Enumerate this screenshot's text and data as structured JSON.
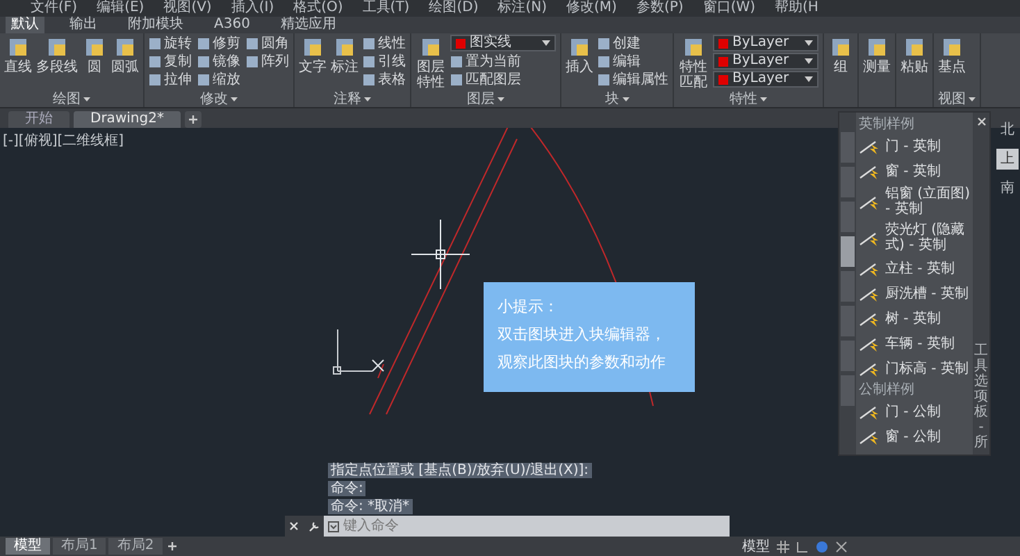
{
  "menu_bar": [
    "文件(F)",
    "编辑(E)",
    "视图(V)",
    "插入(I)",
    "格式(O)",
    "工具(T)",
    "绘图(D)",
    "标注(N)",
    "修改(M)",
    "参数(P)",
    "窗口(W)",
    "帮助(H"
  ],
  "ribbon_tabs": [
    {
      "label": "默认",
      "selected": true
    },
    {
      "label": "输出",
      "selected": false
    },
    {
      "label": "附加模块",
      "selected": false
    },
    {
      "label": "A360",
      "selected": false
    },
    {
      "label": "精选应用",
      "selected": false
    }
  ],
  "ribbon_panels": [
    {
      "title": "绘图",
      "tools": [
        {
          "kind": "large",
          "label": "直线"
        },
        {
          "kind": "large",
          "label": "多段线"
        },
        {
          "kind": "large",
          "label": "圆"
        },
        {
          "kind": "large",
          "label": "圆弧"
        }
      ]
    },
    {
      "title": "修改",
      "tools": [
        {
          "kind": "small",
          "label": "旋转"
        },
        {
          "kind": "small",
          "label": "复制"
        },
        {
          "kind": "small",
          "label": "拉伸"
        },
        {
          "kind": "small",
          "label": "修剪"
        },
        {
          "kind": "small",
          "label": "镜像"
        },
        {
          "kind": "small",
          "label": "缩放"
        },
        {
          "kind": "small",
          "label": "圆角"
        },
        {
          "kind": "small",
          "label": "阵列"
        }
      ]
    },
    {
      "title": "注释",
      "tools": [
        {
          "kind": "large",
          "label": "文字"
        },
        {
          "kind": "large",
          "label": "标注"
        },
        {
          "kind": "small",
          "label": "线性"
        },
        {
          "kind": "small",
          "label": "引线"
        },
        {
          "kind": "small",
          "label": "表格"
        }
      ]
    },
    {
      "title": "图层",
      "tools": [
        {
          "kind": "large",
          "label": "图层特性"
        },
        {
          "kind": "dropdown",
          "label": "图实线"
        },
        {
          "kind": "small",
          "label": "置为当前"
        },
        {
          "kind": "small",
          "label": "匹配图层"
        }
      ]
    },
    {
      "title": "块",
      "tools": [
        {
          "kind": "large",
          "label": "插入"
        },
        {
          "kind": "small",
          "label": "创建"
        },
        {
          "kind": "small",
          "label": "编辑"
        },
        {
          "kind": "small",
          "label": "编辑属性"
        }
      ]
    },
    {
      "title": "特性",
      "tools": [
        {
          "kind": "large",
          "label": "特性匹配"
        },
        {
          "kind": "dropdown",
          "label": "ByLayer"
        },
        {
          "kind": "dropdown",
          "label": "ByLayer"
        },
        {
          "kind": "dropdown",
          "label": "ByLayer"
        }
      ]
    },
    {
      "tools": [
        {
          "kind": "large",
          "label": "组"
        }
      ]
    },
    {
      "tools": [
        {
          "kind": "large",
          "label": "测量"
        }
      ]
    },
    {
      "tools": [
        {
          "kind": "large",
          "label": "粘贴"
        }
      ]
    },
    {
      "title": "视图",
      "tools": [
        {
          "kind": "large",
          "label": "基点"
        }
      ]
    }
  ],
  "document_tabs": [
    {
      "label": "开始",
      "selected": false
    },
    {
      "label": "Drawing2*",
      "selected": true
    }
  ],
  "viewport_label": "[-][俯视][二维线框]",
  "tool_palette": {
    "side_title": "工具选项板 - 所",
    "tabs": [
      {
        "selected": false
      },
      {
        "selected": false
      },
      {
        "selected": false
      },
      {
        "selected": true
      },
      {
        "selected": false
      },
      {
        "selected": false
      },
      {
        "selected": false
      },
      {
        "selected": false
      }
    ],
    "sections": [
      {
        "title": "英制样例",
        "items": [
          "门 - 英制",
          "窗 - 英制",
          "铝窗 (立面图) - 英制",
          "荧光灯 (隐藏式) - 英制",
          "立柱 - 英制",
          "厨洗槽 - 英制",
          "树 - 英制",
          "车辆 - 英制",
          "门标高 - 英制"
        ]
      },
      {
        "title": "公制样例",
        "items": [
          "门 - 公制",
          "窗 - 公制"
        ]
      }
    ]
  },
  "view_cube": {
    "north": "北",
    "top": "上",
    "south": "南"
  },
  "tip": {
    "title": "小提示：",
    "lines": [
      "双击图块进入块编辑器，",
      "观察此图块的参数和动作"
    ]
  },
  "command_history": [
    "指定点位置或 [基点(B)/放弃(U)/退出(X)]:",
    "命令:",
    "命令: *取消*"
  ],
  "command_line": {
    "placeholder": "键入命令"
  },
  "layout_tabs": [
    {
      "label": "模型",
      "selected": true
    },
    {
      "label": "布局1",
      "selected": false
    },
    {
      "label": "布局2",
      "selected": false
    }
  ],
  "status_bar": {
    "space": "模型"
  }
}
